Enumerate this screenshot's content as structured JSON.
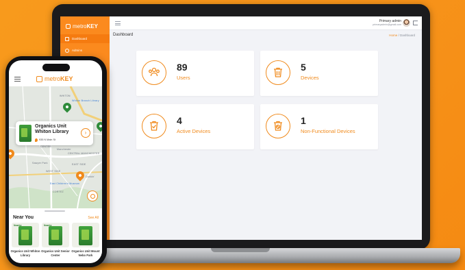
{
  "laptop": {
    "brand": {
      "prefix": "metro",
      "suffix": "KEY"
    },
    "sidebar": {
      "items": [
        {
          "label": "Dashboard",
          "active": true
        },
        {
          "label": "Admins",
          "active": false
        }
      ]
    },
    "topbar": {
      "admin_name": "Primary admin",
      "admin_email": "primaryadmin@gmail.com"
    },
    "page_title": "Dashboard",
    "breadcrumb": {
      "home": "Home",
      "separator": " / ",
      "current": "Dashboard"
    },
    "stats": [
      {
        "value": "89",
        "label": "Users",
        "icon": "users-icon"
      },
      {
        "value": "5",
        "label": "Devices",
        "icon": "trash-bin-icon"
      },
      {
        "value": "4",
        "label": "Active Devices",
        "icon": "active-bin-icon"
      },
      {
        "value": "1",
        "label": "Non-Functional Devices",
        "icon": "broken-bin-icon"
      }
    ],
    "accent_color": "#f08a1c"
  },
  "phone": {
    "brand": {
      "prefix": "metro",
      "suffix": "KEY"
    },
    "map": {
      "labels": [
        "WHITON",
        "Whiton Branch Library",
        "CENTRAL MANCHESTER",
        "Manchester",
        "CENTER",
        "St Mark Kloss Grocery Store",
        "EAST SIDE",
        "WEST SIDE",
        "Sawyer Park",
        "CORTEZ",
        "East Children's Museum",
        "Dunkin'"
      ],
      "card": {
        "title": "Organics Unit Whiton Library",
        "address": "935 N Main St"
      }
    },
    "near_you": {
      "title": "Near You",
      "see_all": "See All",
      "items": [
        {
          "tag": "Nearby",
          "name": "Organics Unit Whiton Library"
        },
        {
          "tag": "Nearby",
          "name": "Organics Unit Senior Center"
        },
        {
          "tag": "",
          "name": "Organics Unit Mount Nebo Park"
        }
      ]
    }
  }
}
